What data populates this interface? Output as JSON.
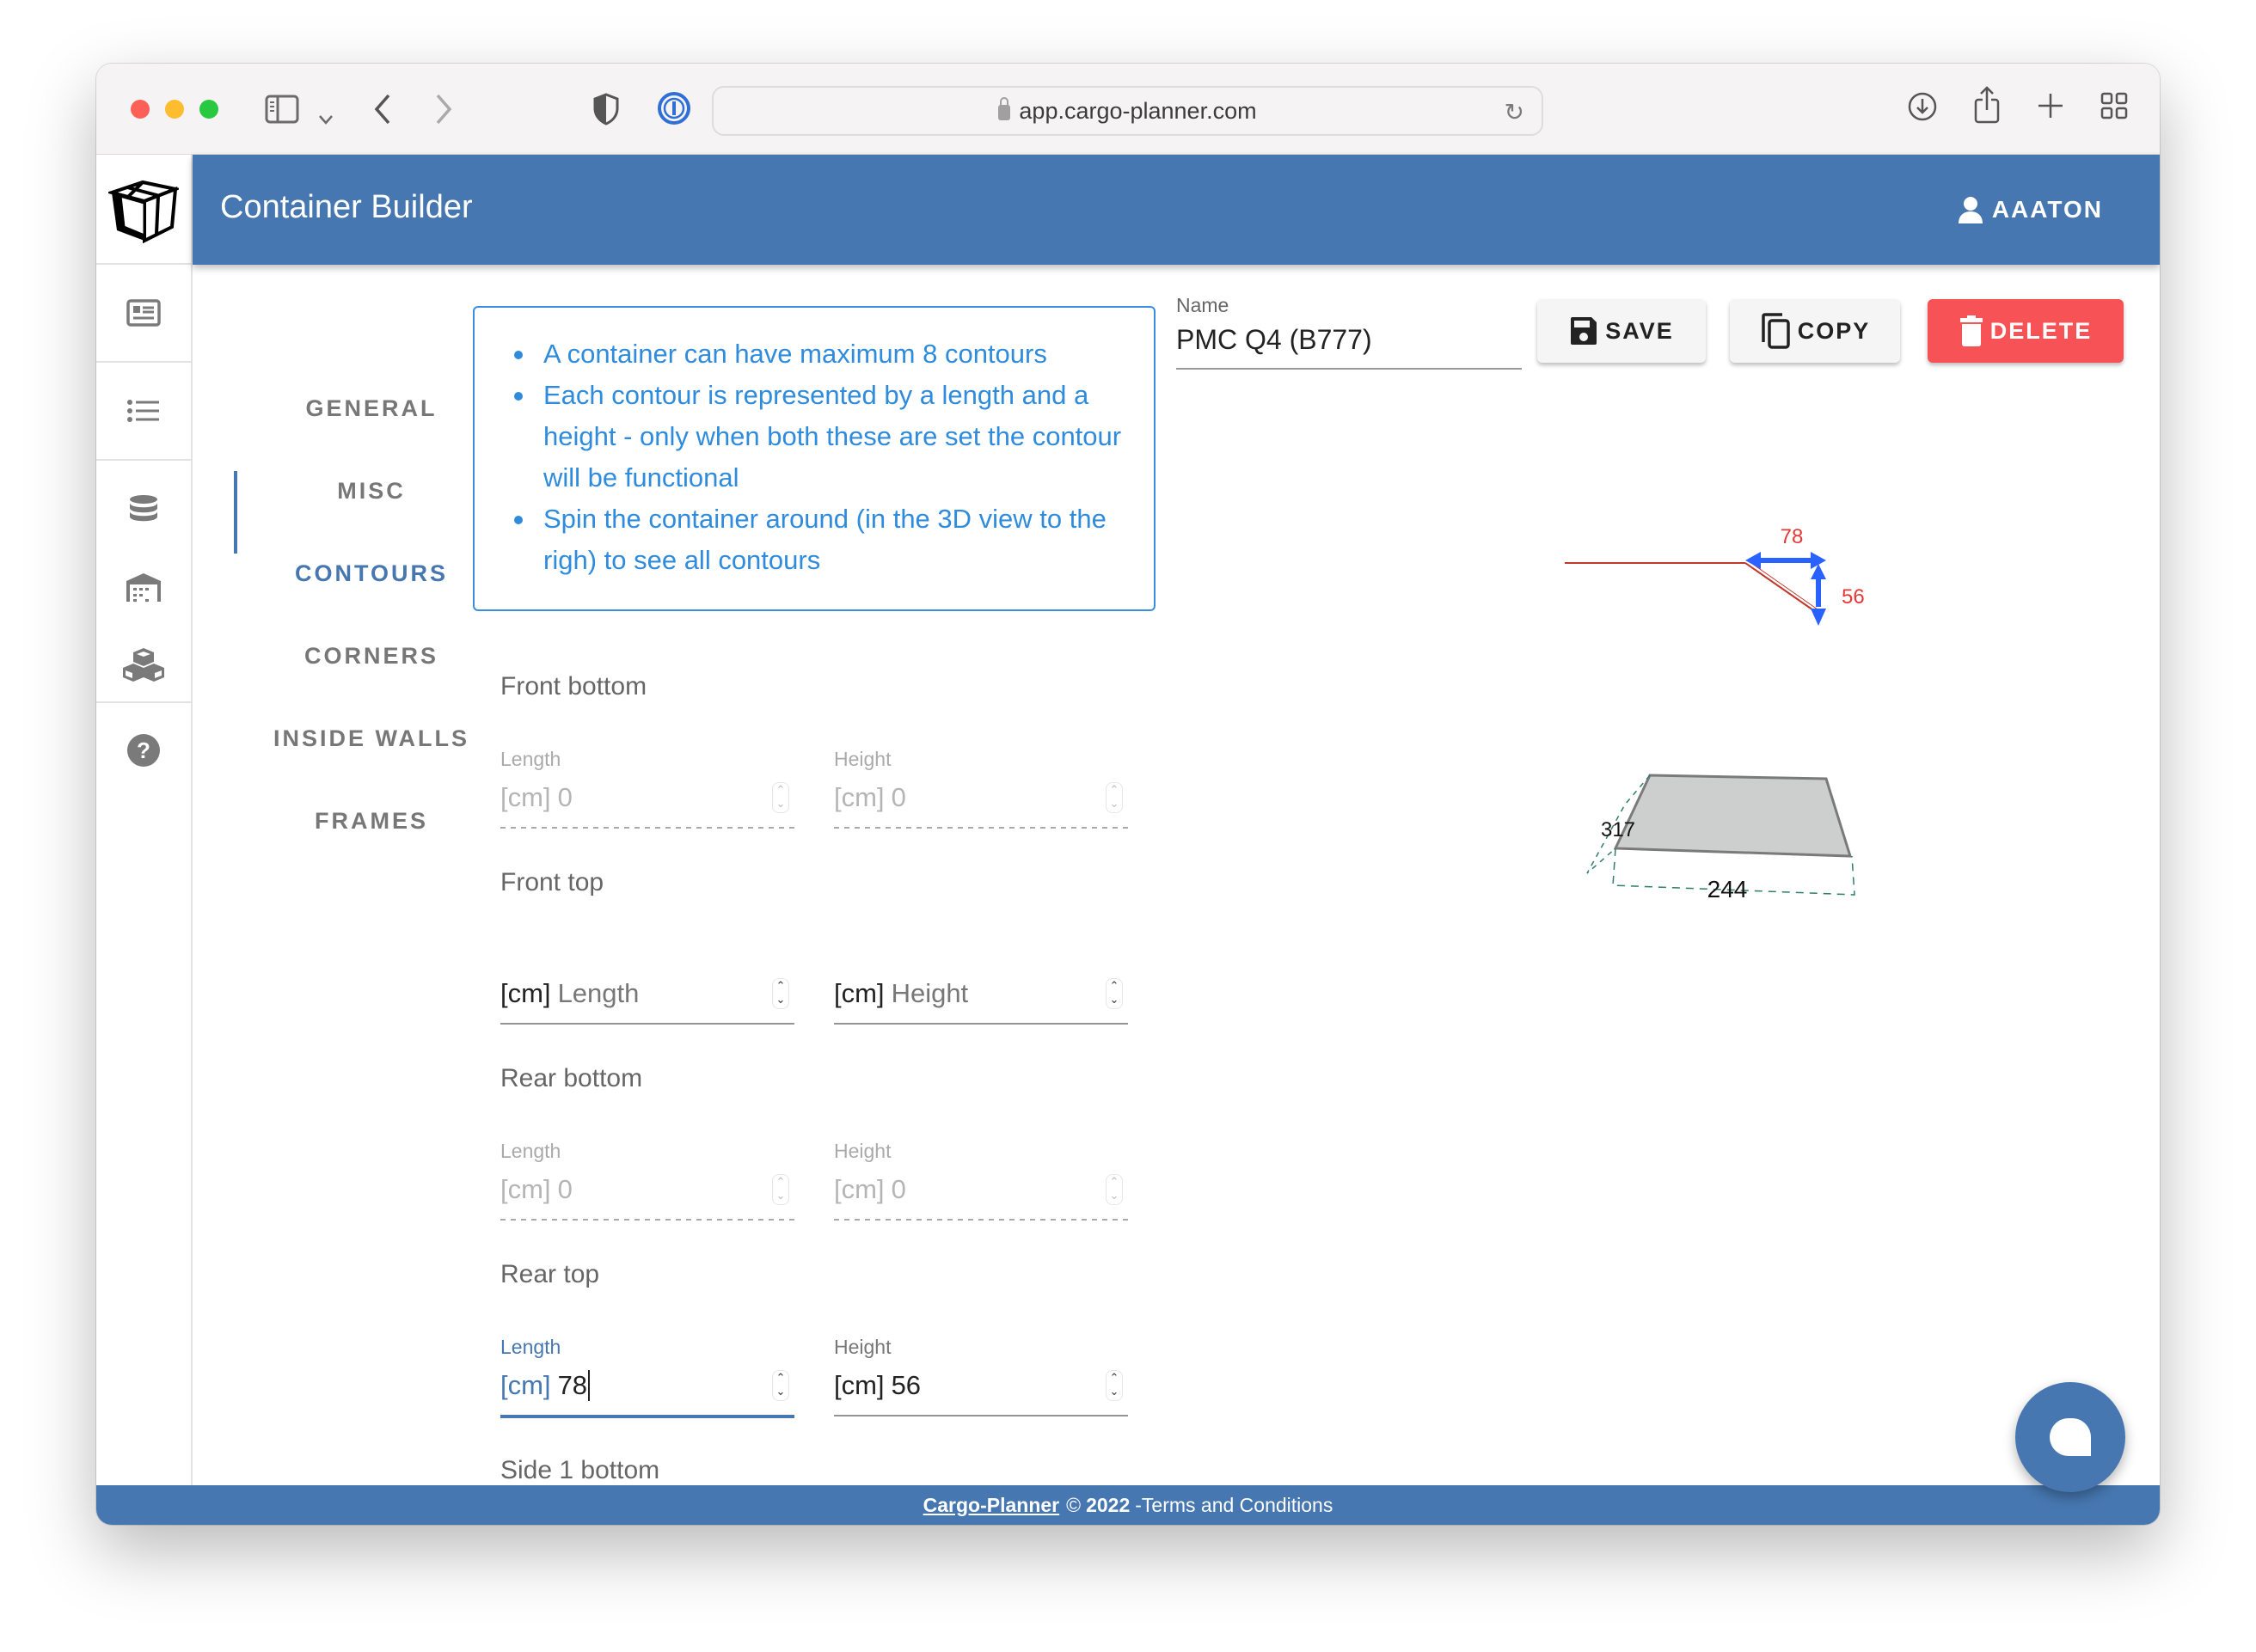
{
  "browser": {
    "url": "app.cargo-planner.com",
    "icons": [
      "sidebar-toggle-icon",
      "chevron-down-icon",
      "back-icon",
      "forward-icon",
      "shield-icon",
      "password-manager-icon",
      "lock-icon",
      "reload-icon",
      "download-icon",
      "share-icon",
      "new-tab-icon",
      "tab-overview-icon"
    ]
  },
  "app": {
    "title": "Container Builder",
    "user": "AAATON",
    "accent_color": "#4677b0"
  },
  "sidebar": {
    "items": [
      {
        "icon": "form-icon"
      },
      {
        "icon": "list-icon"
      },
      {
        "icon": "database-icon"
      },
      {
        "icon": "warehouse-icon"
      },
      {
        "icon": "boxes-icon"
      },
      {
        "icon": "help-icon"
      }
    ]
  },
  "nav": {
    "items": [
      {
        "label": "GENERAL",
        "active": false
      },
      {
        "label": "MISC",
        "active": false
      },
      {
        "label": "CONTOURS",
        "active": true
      },
      {
        "label": "CORNERS",
        "active": false
      },
      {
        "label": "INSIDE WALLS",
        "active": false
      },
      {
        "label": "FRAMES",
        "active": false
      }
    ]
  },
  "info": {
    "bullets": [
      "A container can have maximum 8 contours",
      "Each contour is represented by a length and a height - only when both these are set the contour will be functional",
      "Spin the container around (in the 3D view to the righ) to see all contours"
    ]
  },
  "name_field": {
    "label": "Name",
    "value": "PMC Q4 (B777)"
  },
  "actions": {
    "save": "SAVE",
    "copy": "COPY",
    "delete": "DELETE",
    "delete_color": "#f75356"
  },
  "contours": [
    {
      "title": "Front bottom",
      "length": {
        "label": "Length",
        "prefix": "[cm]",
        "value": "0",
        "state": "disabled"
      },
      "height": {
        "label": "Height",
        "prefix": "[cm]",
        "value": "0",
        "state": "disabled"
      }
    },
    {
      "title": "Front top",
      "length": {
        "label": "",
        "prefix": "[cm]",
        "placeholder": "Length",
        "state": "empty"
      },
      "height": {
        "label": "",
        "prefix": "[cm]",
        "placeholder": "Height",
        "state": "empty"
      }
    },
    {
      "title": "Rear bottom",
      "length": {
        "label": "Length",
        "prefix": "[cm]",
        "value": "0",
        "state": "disabled"
      },
      "height": {
        "label": "Height",
        "prefix": "[cm]",
        "value": "0",
        "state": "disabled"
      }
    },
    {
      "title": "Rear top",
      "length": {
        "label": "Length",
        "prefix": "[cm]",
        "value": "78",
        "state": "focused"
      },
      "height": {
        "label": "Height",
        "prefix": "[cm]",
        "value": "56",
        "state": "filled"
      }
    },
    {
      "title": "Side 1 bottom"
    }
  ],
  "visualization": {
    "contour_length_label": "78",
    "contour_height_label": "56",
    "depth_label": "317",
    "width_label": "244",
    "dimension_label_color": "#e53935",
    "arrow_color": "#2962ff"
  },
  "footer": {
    "brand": "Cargo-Planner",
    "copyright": "©",
    "year": "2022",
    "terms": "-Terms and Conditions"
  }
}
